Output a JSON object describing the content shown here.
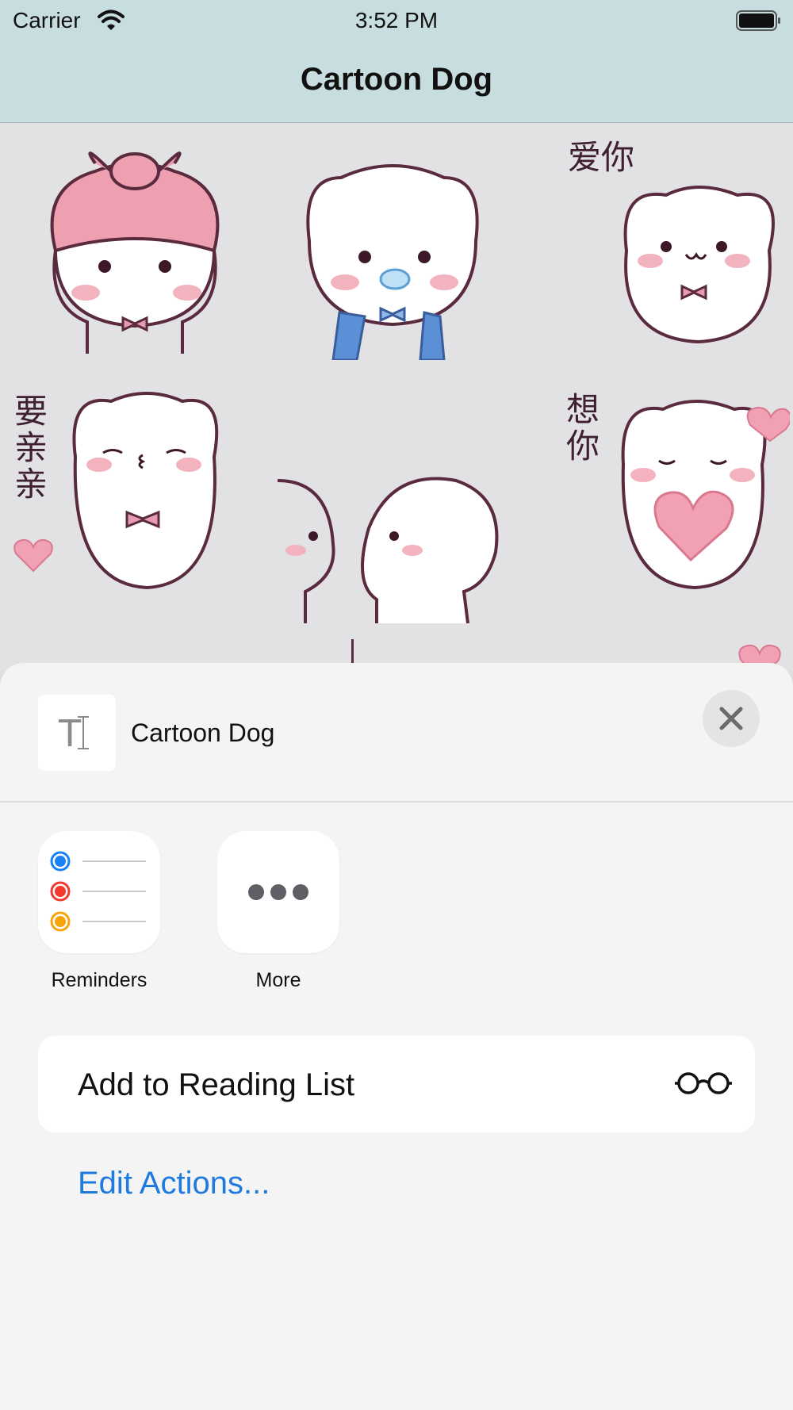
{
  "status_bar": {
    "carrier": "Carrier",
    "time": "3:52 PM",
    "wifi_icon": "wifi-icon",
    "battery_icon": "battery-icon"
  },
  "nav": {
    "title": "Cartoon Dog"
  },
  "stickers": {
    "captions": [
      "爱你",
      "要亲亲",
      "想你"
    ],
    "colors": {
      "outline": "#5a2a3e",
      "blush": "#f2b3bf",
      "bow": "#e79ab0",
      "scarf": "#5b8fd6"
    }
  },
  "share_sheet": {
    "doc_icon": "text-document-icon",
    "doc_icon_glyph": "T",
    "title": "Cartoon Dog",
    "close_icon": "close-icon",
    "apps": [
      {
        "label": "Reminders",
        "icon": "reminders-icon"
      },
      {
        "label": "More",
        "icon": "more-icon"
      }
    ],
    "actions": [
      {
        "label": "Add to Reading List",
        "icon": "reading-glasses-icon"
      }
    ],
    "edit_actions": "Edit Actions..."
  },
  "colors": {
    "nav_bg": "#c8dde0",
    "sheet_bg": "#f4f4f4",
    "accent_blue": "#1f7ae0",
    "reminder_blue": "#1a82f7",
    "reminder_red": "#f23a30",
    "reminder_orange": "#f8a30a"
  }
}
